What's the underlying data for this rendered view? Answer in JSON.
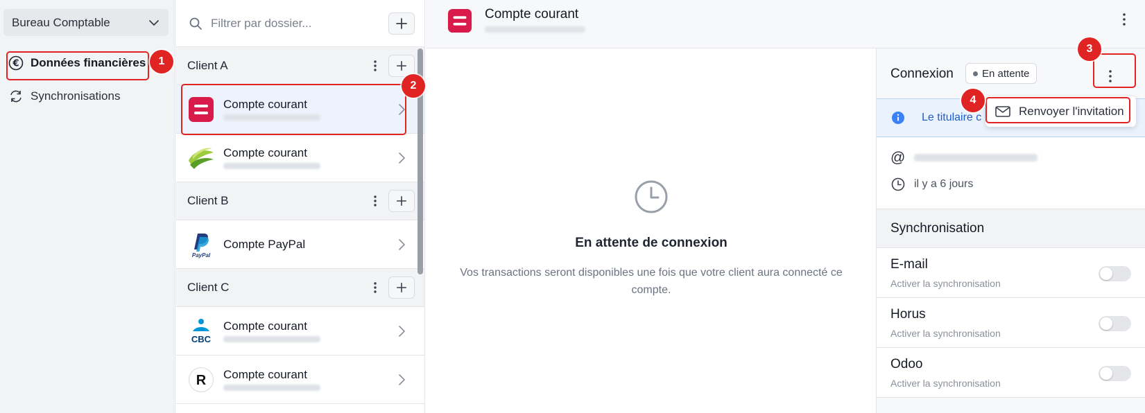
{
  "sidebar": {
    "org_name": "Bureau Comptable",
    "nav": [
      {
        "label": "Données financières",
        "icon": "euro-icon",
        "active": true
      },
      {
        "label": "Synchronisations",
        "icon": "sync-icon",
        "active": false
      }
    ]
  },
  "account_list": {
    "search_placeholder": "Filtrer par dossier...",
    "groups": [
      {
        "name": "Client A",
        "accounts": [
          {
            "name": "Compte courant",
            "logo": "red-bank-logo",
            "selected": true
          },
          {
            "name": "Compte courant",
            "logo": "green-bank-logo"
          }
        ]
      },
      {
        "name": "Client B",
        "accounts": [
          {
            "name": "Compte PayPal",
            "logo": "paypal-logo"
          }
        ]
      },
      {
        "name": "Client C",
        "accounts": [
          {
            "name": "Compte courant",
            "logo": "cbc-logo"
          },
          {
            "name": "Compte courant",
            "logo": "revolut-logo"
          }
        ]
      }
    ]
  },
  "header": {
    "title": "Compte courant"
  },
  "main": {
    "empty_title": "En attente de connexion",
    "empty_desc": "Vos transactions seront disponibles une fois que votre client aura connecté ce compte."
  },
  "panel": {
    "connection_title": "Connexion",
    "status": "En attente",
    "info_text": "Le titulaire c",
    "at_symbol": "@",
    "last_activity": "il y a 6 jours",
    "sync_title": "Synchronisation",
    "sync_items": [
      {
        "name": "E-mail",
        "desc": "Activer la synchronisation",
        "enabled": false
      },
      {
        "name": "Horus",
        "desc": "Activer la synchronisation",
        "enabled": false
      },
      {
        "name": "Odoo",
        "desc": "Activer la synchronisation",
        "enabled": false
      }
    ]
  },
  "dropdown": {
    "resend_label": "Renvoyer l'invitation"
  },
  "annotations": {
    "m1": "1",
    "m2": "2",
    "m3": "3",
    "m4": "4"
  },
  "logo_text": {
    "paypal": "PayPal",
    "cbc": "CBC",
    "revolut": "R"
  },
  "colors": {
    "accent": "#e02424",
    "brand_red": "#d81b4a",
    "info_blue": "#1f5ec9"
  }
}
